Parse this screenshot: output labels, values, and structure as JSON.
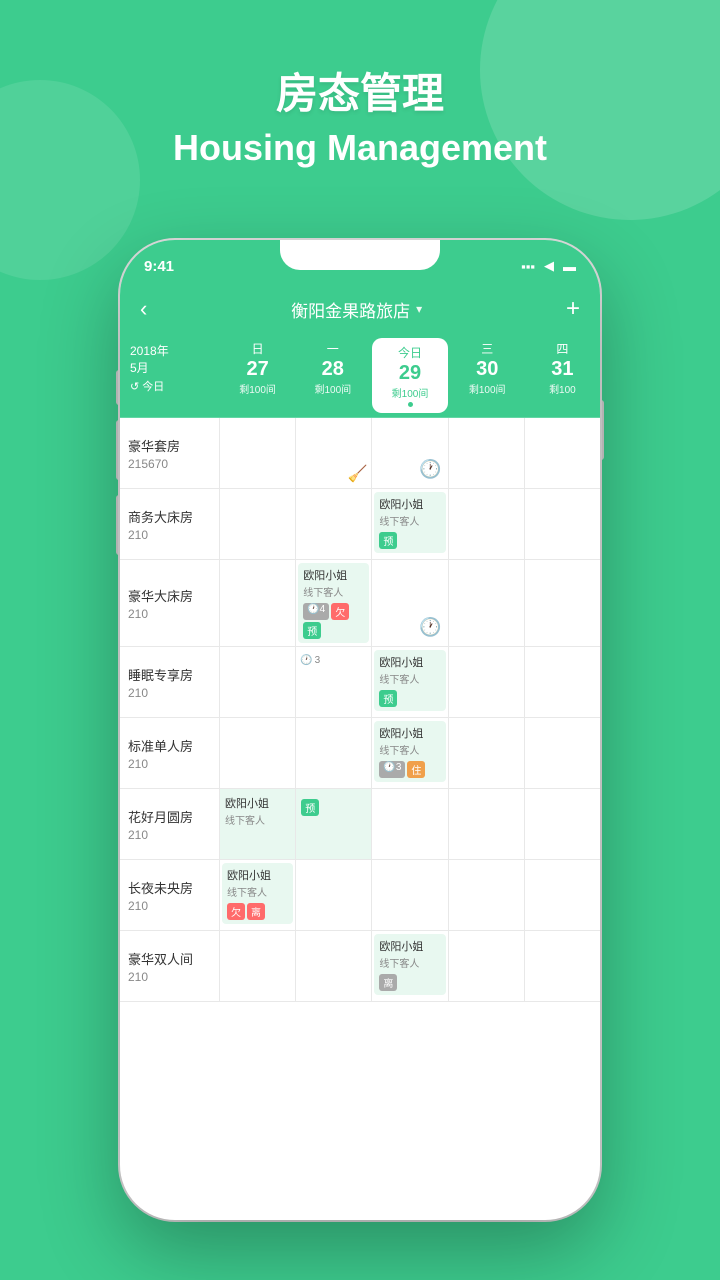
{
  "background_color": "#3dcc8e",
  "title": {
    "zh": "房态管理",
    "en": "Housing Management"
  },
  "status_bar": {
    "time": "9:41",
    "icons": "▪▪▪ ◀ ▬"
  },
  "header": {
    "back_label": "‹",
    "store_name": "衡阳金果路旅店",
    "dropdown_icon": "▾",
    "add_icon": "+"
  },
  "date_header": {
    "year": "2018年",
    "month": "5月",
    "today_label": "↺ 今日",
    "columns": [
      {
        "day_name": "日",
        "date": "27",
        "rooms": "剩100间",
        "active": false
      },
      {
        "day_name": "一",
        "date": "28",
        "rooms": "剩100间",
        "active": false
      },
      {
        "day_name": "今日",
        "date": "29",
        "rooms": "剩100间",
        "active": true
      },
      {
        "day_name": "三",
        "date": "30",
        "rooms": "剩100间",
        "active": false
      },
      {
        "day_name": "四",
        "date": "31",
        "rooms": "剩100",
        "active": false
      }
    ]
  },
  "rooms": [
    {
      "name": "豪华套房",
      "price": "215670",
      "cells": [
        {
          "type": "empty"
        },
        {
          "type": "empty"
        },
        {
          "type": "clock"
        },
        {
          "type": "empty"
        },
        {
          "type": "empty"
        }
      ]
    },
    {
      "name": "商务大床房",
      "price": "210",
      "cells": [
        {
          "type": "empty"
        },
        {
          "type": "empty"
        },
        {
          "type": "booking",
          "name": "欧阳小姐",
          "sub": "线下客人",
          "tags": [
            {
              "label": "预",
              "color": "green"
            }
          ]
        },
        {
          "type": "empty"
        },
        {
          "type": "empty"
        }
      ]
    },
    {
      "name": "豪华大床房",
      "price": "210",
      "cells": [
        {
          "type": "empty"
        },
        {
          "type": "booking_clock",
          "name": "欧阳小姐",
          "sub": "线下客人",
          "tags": [
            {
              "label": "🕐4",
              "color": "gray"
            },
            {
              "label": "欠",
              "color": "red"
            },
            {
              "label": "预",
              "color": "green"
            }
          ]
        },
        {
          "type": "clock"
        },
        {
          "type": "empty"
        },
        {
          "type": "empty"
        }
      ]
    },
    {
      "name": "睡眠专享房",
      "price": "210",
      "cells": [
        {
          "type": "empty"
        },
        {
          "type": "clock3"
        },
        {
          "type": "booking",
          "name": "欧阳小姐",
          "sub": "线下客人",
          "tags": [
            {
              "label": "预",
              "color": "green"
            }
          ]
        },
        {
          "type": "empty"
        },
        {
          "type": "empty"
        }
      ]
    },
    {
      "name": "标准单人房",
      "price": "210",
      "cells": [
        {
          "type": "empty"
        },
        {
          "type": "empty"
        },
        {
          "type": "booking",
          "name": "欧阳小姐",
          "sub": "线下客人",
          "tags": [
            {
              "label": "🕐3",
              "color": "gray"
            },
            {
              "label": "住",
              "color": "orange"
            }
          ]
        },
        {
          "type": "empty"
        },
        {
          "type": "empty"
        }
      ]
    },
    {
      "name": "花好月圆房",
      "price": "210",
      "cells": [
        {
          "type": "booking_ext",
          "name": "欧阳小姐",
          "sub": "线下客人"
        },
        {
          "type": "booking_tag",
          "tags": [
            {
              "label": "预",
              "color": "green"
            }
          ]
        },
        {
          "type": "empty"
        },
        {
          "type": "empty"
        },
        {
          "type": "empty"
        }
      ]
    },
    {
      "name": "长夜未央房",
      "price": "210",
      "cells": [
        {
          "type": "booking_ext2",
          "name": "欧阳小姐",
          "sub": "线下客人",
          "tags": [
            {
              "label": "欠",
              "color": "red"
            },
            {
              "label": "离",
              "color": "red"
            }
          ]
        },
        {
          "type": "empty"
        },
        {
          "type": "empty"
        },
        {
          "type": "empty"
        },
        {
          "type": "empty"
        }
      ]
    },
    {
      "name": "豪华双人间",
      "price": "210",
      "cells": [
        {
          "type": "empty"
        },
        {
          "type": "empty"
        },
        {
          "type": "booking_离",
          "name": "欧阳小姐",
          "sub": "线下客人",
          "tags": [
            {
              "label": "离",
              "color": "gray"
            }
          ]
        },
        {
          "type": "empty"
        },
        {
          "type": "empty"
        }
      ]
    }
  ]
}
